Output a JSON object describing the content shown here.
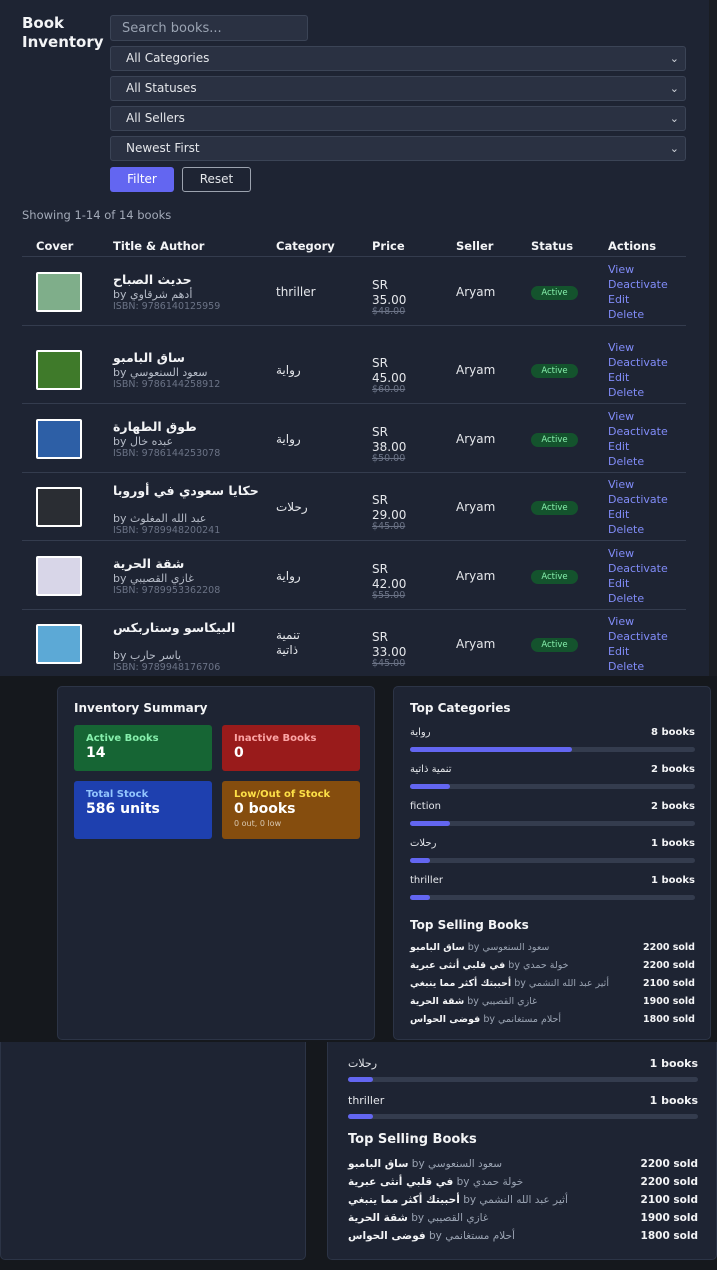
{
  "header": {
    "title": "Book Inventory",
    "search_placeholder": "Search books...",
    "filters": [
      "All Categories",
      "All Statuses",
      "All Sellers",
      "Newest First"
    ],
    "filter_label": "Filter",
    "reset_label": "Reset",
    "showing": "Showing 1-14 of 14 books"
  },
  "table": {
    "columns": [
      "Cover",
      "Title & Author",
      "Category",
      "Price",
      "Seller",
      "Status",
      "Actions"
    ],
    "actions": [
      "View",
      "Deactivate",
      "Edit",
      "Delete"
    ],
    "rows": [
      {
        "title": "حديث الصباح",
        "author": "by أدهم شرقاوي",
        "isbn": "ISBN: 9786140125959",
        "category": "thriller",
        "currency": "SR",
        "price": "35.00",
        "old_price": "$48.00",
        "seller": "Aryam",
        "status": "Active",
        "cover_color": "#7fae8a"
      },
      {
        "title": "ساق البامبو",
        "author": "by سعود السنعوسي",
        "isbn": "ISBN: 9786144258912",
        "category": "رواية",
        "currency": "SR",
        "price": "45.00",
        "old_price": "$60.00",
        "seller": "Aryam",
        "status": "Active",
        "cover_color": "#3f7a2a"
      },
      {
        "title": "طوق الطهارة",
        "author": "by عبده خال",
        "isbn": "ISBN: 9786144253078",
        "category": "رواية",
        "currency": "SR",
        "price": "38.00",
        "old_price": "$50.00",
        "seller": "Aryam",
        "status": "Active",
        "cover_color": "#2d5fa6"
      },
      {
        "title": "حكايا سعودي في أوروبا",
        "author": "by عبد الله المغلوث",
        "isbn": "ISBN: 9789948200241",
        "category": "رحلات",
        "currency": "SR",
        "price": "29.00",
        "old_price": "$45.00",
        "seller": "Aryam",
        "status": "Active",
        "cover_color": "#2a2d33"
      },
      {
        "title": "شقة الحرية",
        "author": "by غازي القصيبي",
        "isbn": "ISBN: 9789953362208",
        "category": "رواية",
        "currency": "SR",
        "price": "42.00",
        "old_price": "$55.00",
        "seller": "Aryam",
        "status": "Active",
        "cover_color": "#d8d6e8"
      },
      {
        "title": "البيكاسو وستاربكس",
        "author": "by ياسر حارب",
        "isbn": "ISBN: 9789948176706",
        "category": "تنمية ذاتية",
        "currency": "SR",
        "price": "33.00",
        "old_price": "$45.00",
        "seller": "Aryam",
        "status": "Active",
        "cover_color": "#5ca9d6"
      }
    ]
  },
  "summary": {
    "title": "Inventory Summary",
    "active_label": "Active Books",
    "active_value": "14",
    "inactive_label": "Inactive Books",
    "inactive_value": "0",
    "stock_label": "Total Stock",
    "stock_value": "586 units",
    "low_label": "Low/Out of Stock",
    "low_value": "0 books",
    "low_sub": "0 out, 0 low",
    "colors": {
      "active": "#166534",
      "inactive": "#991b1b",
      "stock": "#1e40af",
      "low": "#854d0e"
    }
  },
  "categories": {
    "title": "Top Categories",
    "items": [
      {
        "name": "رواية",
        "count": "8 books",
        "fraction": 0.57
      },
      {
        "name": "تنمية ذاتية",
        "count": "2 books",
        "fraction": 0.14
      },
      {
        "name": "fiction",
        "count": "2 books",
        "fraction": 0.14
      },
      {
        "name": "رحلات",
        "count": "1 books",
        "fraction": 0.07
      },
      {
        "name": "thriller",
        "count": "1 books",
        "fraction": 0.07
      }
    ]
  },
  "top_selling": {
    "title": "Top Selling Books",
    "items": [
      {
        "title": "ساق البامبو",
        "author": "by سعود السنعوسي",
        "sold": "2200 sold"
      },
      {
        "title": "في قلبي أنثى عبرية",
        "author": "by خولة حمدي",
        "sold": "2200 sold"
      },
      {
        "title": "أحببتك أكثر مما ينبغي",
        "author": "by أثير عبد الله النشمي",
        "sold": "2100 sold"
      },
      {
        "title": "شقة الحرية",
        "author": "by غازي القصيبي",
        "sold": "1900 sold"
      },
      {
        "title": "فوضى الحواس",
        "author": "by أحلام مستغانمي",
        "sold": "1800 sold"
      }
    ]
  }
}
